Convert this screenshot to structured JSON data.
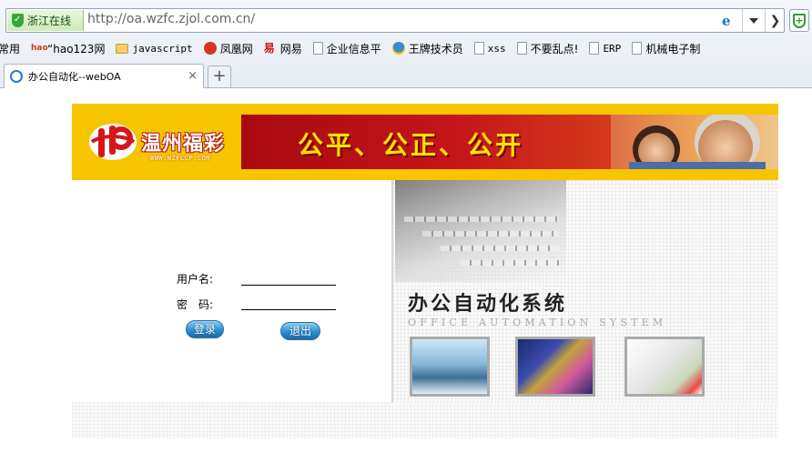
{
  "browser": {
    "security_badge": "浙江在线",
    "url": "http://oa.wzfc.zjol.com.cn/",
    "bookmarks": [
      {
        "label": "常用",
        "icon": "none"
      },
      {
        "label": "“hao123网",
        "icon": "hao123-icon"
      },
      {
        "label": "javascript",
        "icon": "folder-icon"
      },
      {
        "label": "凤凰网",
        "icon": "ifeng-icon"
      },
      {
        "label": "网易",
        "icon": "netease-icon"
      },
      {
        "label": "企业信息平",
        "icon": "page-icon"
      },
      {
        "label": "王牌技术员",
        "icon": "qq-icon"
      },
      {
        "label": "xss",
        "icon": "page-icon"
      },
      {
        "label": "不要乱点!",
        "icon": "page-icon"
      },
      {
        "label": "ERP",
        "icon": "page-icon"
      },
      {
        "label": "机械电子制",
        "icon": "page-icon"
      }
    ],
    "tab": {
      "title": "办公自动化--webOA",
      "close": "×"
    },
    "new_tab": "+"
  },
  "banner": {
    "logo_text": "温州福彩",
    "logo_url": "WWW.WZFLCP.COM",
    "slogan": "公平、公正、公开"
  },
  "system": {
    "title": "办公自动化系统",
    "subtitle": "OFFICE AUTOMATION SYSTEM"
  },
  "login": {
    "username_label": "用户名:",
    "password_label": "密　码:",
    "username_value": "",
    "password_value": "",
    "login_button": "登录",
    "exit_button": "退出"
  },
  "colors": {
    "banner_yellow": "#f7c400",
    "slogan_red": "#c5151a",
    "slogan_text": "#ffe400",
    "button_blue": "#2b8fd1"
  }
}
